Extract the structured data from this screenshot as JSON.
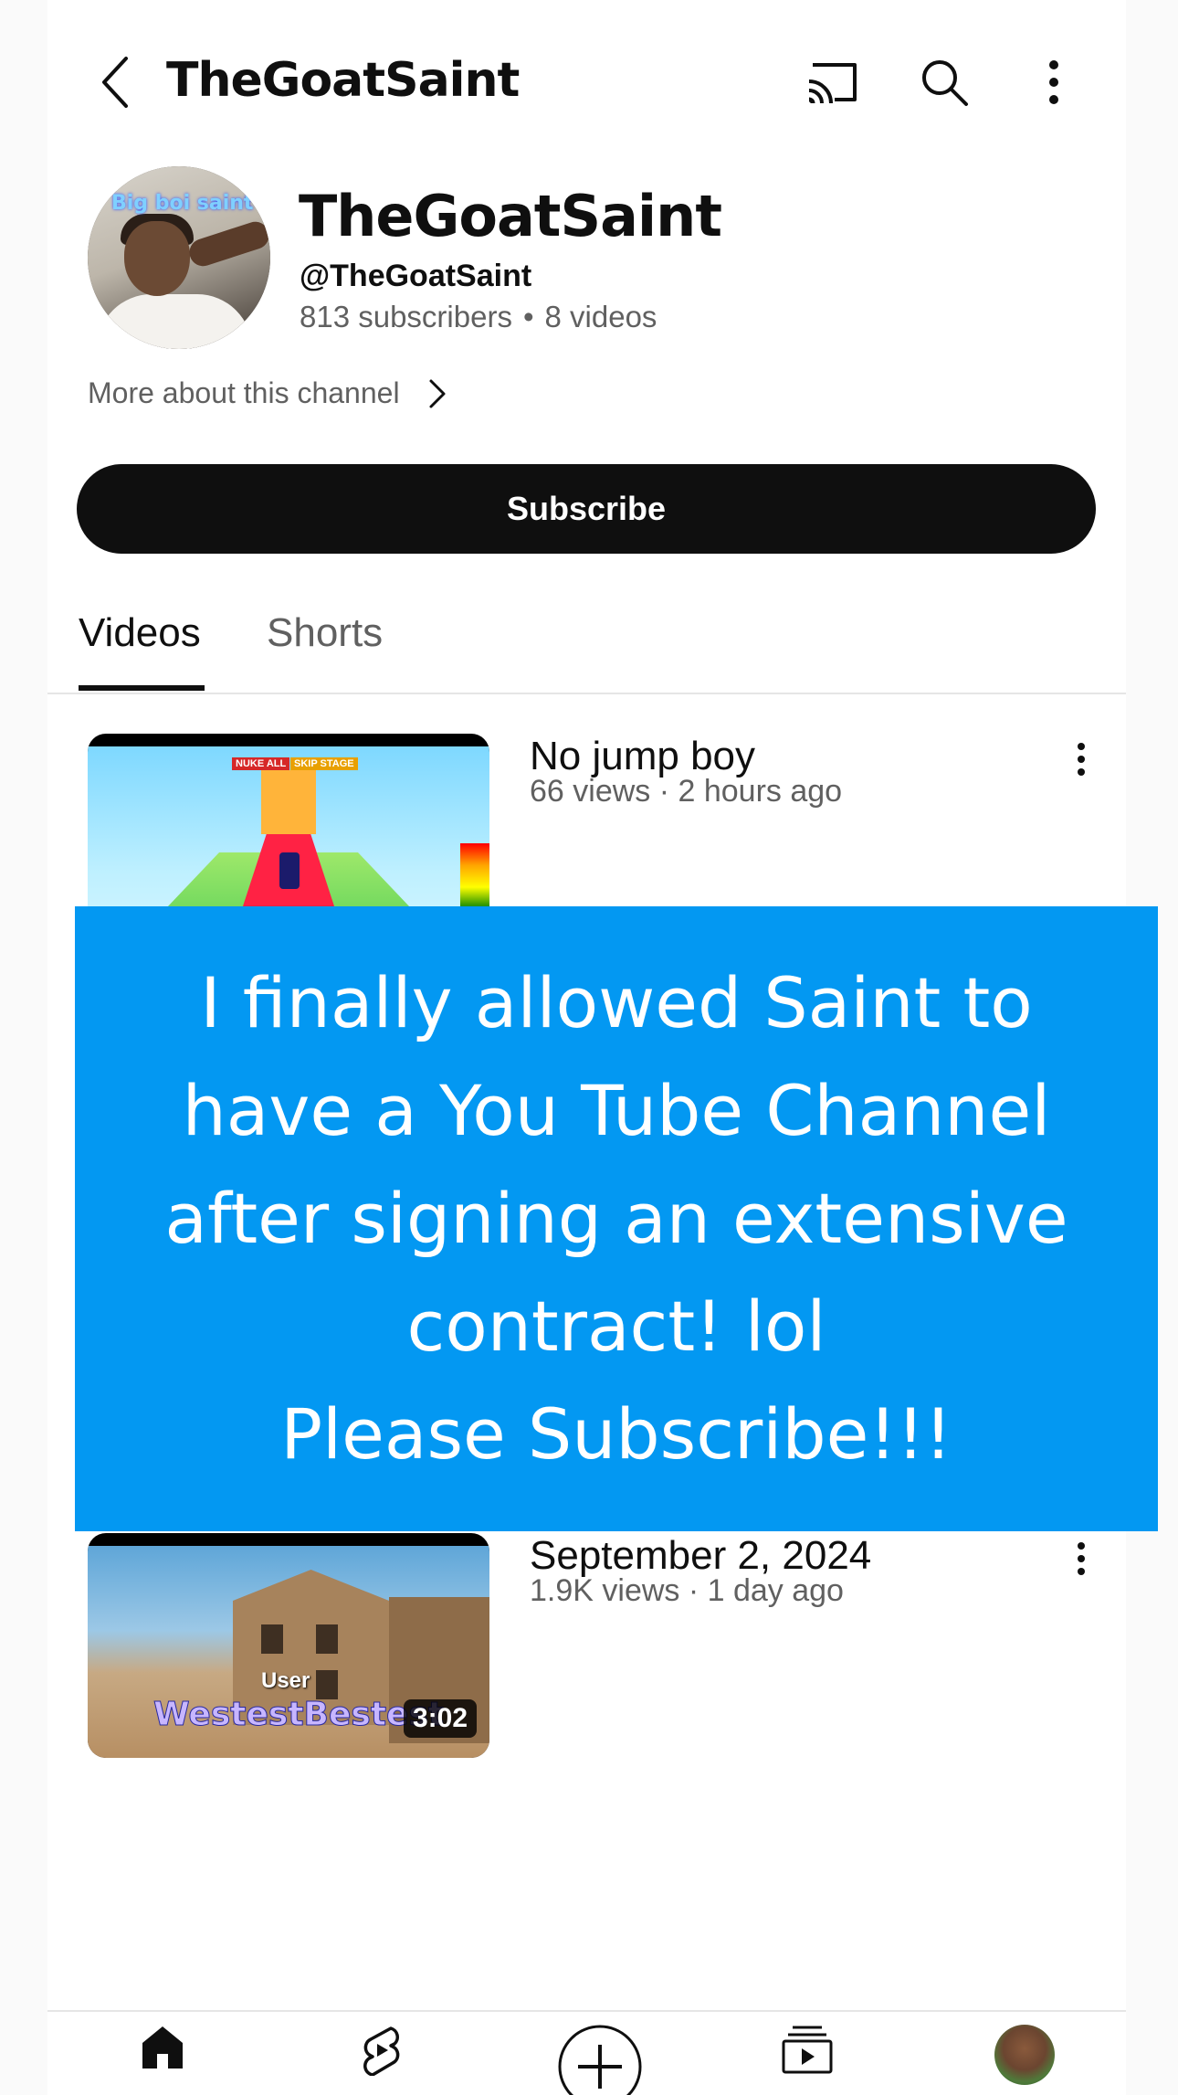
{
  "topbar": {
    "title": "TheGoatSaint",
    "icons": [
      "back-arrow-icon",
      "cast-icon",
      "search-icon",
      "more-vert-icon"
    ]
  },
  "channel": {
    "avatar_text": "Big boi saint",
    "name": "TheGoatSaint",
    "handle": "@TheGoatSaint",
    "subscribers": "813 subscribers",
    "videos_count": "8 videos",
    "separator": "•",
    "more_about": "More about this channel",
    "subscribe_label": "Subscribe"
  },
  "tabs": {
    "videos": "Videos",
    "shorts": "Shorts"
  },
  "videos": [
    {
      "title": "No jump boy",
      "meta": "66 views · 2 hours ago",
      "thumb_labels": {
        "nuke": "NUKE ALL",
        "skip": "SKIP STAGE"
      }
    },
    {
      "title": "September 2, 2024",
      "meta": "1.9K views · 1 day ago",
      "duration": "3:02",
      "thumb_labels": {
        "user": "User",
        "name": "WestestBestest"
      }
    }
  ],
  "banner": {
    "text": "I finally allowed Saint to\nhave a You Tube Channel\nafter signing an extensive\ncontract! lol\nPlease Subscribe!!!",
    "color": "#0398f2"
  },
  "bottom_nav": {
    "icons": [
      "home-icon",
      "shorts-icon",
      "create-plus-icon",
      "subscriptions-icon",
      "you-avatar"
    ]
  },
  "colors": {
    "primary_text": "#0f0f0f",
    "secondary_text": "#606060",
    "subscribe_bg": "#0f0f0f"
  }
}
